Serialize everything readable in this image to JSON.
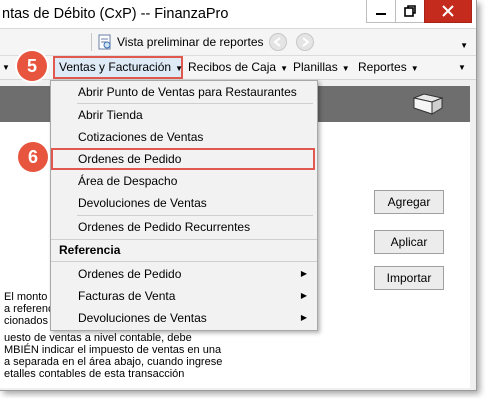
{
  "window": {
    "title": "ntas de Débito (CxP) -- FinanzaPro"
  },
  "toolbar": {
    "preview_label": "Vista preliminar de reportes"
  },
  "menubar": {
    "items": [
      {
        "label": "Ventas y Facturación"
      },
      {
        "label": "Recibos de Caja"
      },
      {
        "label": "Planillas"
      },
      {
        "label": "Reportes"
      }
    ]
  },
  "dropdown": {
    "items": [
      {
        "label": "Abrir Punto de Ventas para Restaurantes"
      },
      {
        "label": "Abrir Tienda"
      },
      {
        "label": "Cotizaciones de Ventas"
      },
      {
        "label": "Ordenes de Pedido"
      },
      {
        "label": "Área de Despacho"
      },
      {
        "label": "Devoluciones de Ventas"
      },
      {
        "label": "Ordenes de Pedido Recurrentes"
      }
    ],
    "section_header": "Referencia",
    "submenu_items": [
      {
        "label": "Ordenes de Pedido"
      },
      {
        "label": "Facturas de Venta"
      },
      {
        "label": "Devoluciones de Ventas"
      }
    ]
  },
  "buttons": {
    "agregar": "Agregar",
    "aplicar": "Aplicar",
    "importar": "Importar"
  },
  "body_text": [
    "El monto d",
    "a referenci",
    "cionados a",
    "uesto de ventas a nivel contable, debe",
    "MBIÉN indicar el impuesto de ventas en una",
    "a separada en el área abajo, cuando ingrese",
    "etalles contables de esta transacción"
  ],
  "annotations": {
    "step_menu": "5",
    "step_item": "6"
  },
  "colors": {
    "annotation": "#e8553e",
    "band": "#6e6e6e",
    "close": "#c42b1c"
  }
}
